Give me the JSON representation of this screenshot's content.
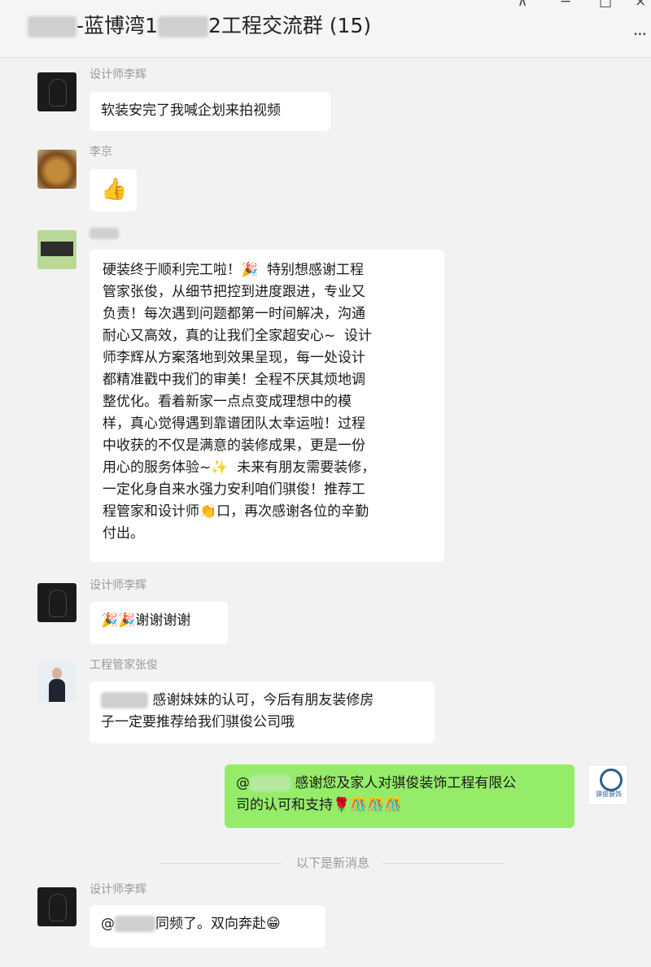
{
  "window": {
    "title_suffix": "-蓝博湾1",
    "title_suffix2": "2工程交流群 (15)",
    "controls": [
      "⊼",
      "−",
      "□",
      "×"
    ],
    "more": "···"
  },
  "messages": [
    {
      "sender": "设计师李辉",
      "text": "软装安完了我喊企划来拍视频"
    },
    {
      "sender": "李京",
      "text": "👍"
    },
    {
      "sender": "",
      "text": "硬装终于顺利完工啦！🎉  特别想感谢工程\n管家张俊，从细节把控到进度跟进，专业又\n负责！每次遇到问题都第一时间解决，沟通\n耐心又高效，真的让我们全家超安心~  设计\n师李辉从方案落地到效果呈现，每一处设计\n都精准戳中我们的审美！全程不厌其烦地调\n整优化。看着新家一点点变成理想中的模\n样，真心觉得遇到靠谱团队太幸运啦！过程\n中收获的不仅是满意的装修成果，更是一份\n用心的服务体验~✨  未来有朋友需要装修，\n一定化身自来水强力安利咱们骐俊！推荐工\n程管家和设计师👏口，再次感谢各位的辛勤\n付出。"
    },
    {
      "sender": "设计师李辉",
      "text": "🎉🎉谢谢谢谢"
    },
    {
      "sender": "工程管家张俊",
      "text": " 感谢妹妹的认可，今后有朋友装修房\n子一定要推荐给我们骐俊公司哦"
    },
    {
      "sender": "self",
      "text": " 感谢您及家人对骐俊装饰工程有限公\n司的认可和支持🌹🎊🎊🎊",
      "prefix": "@"
    },
    {
      "sender": "设计师李辉",
      "text": "同频了。双向奔赴😁",
      "prefix": "@"
    }
  ],
  "separator": "以下是新消息",
  "logo_text": "骐俊装饰"
}
